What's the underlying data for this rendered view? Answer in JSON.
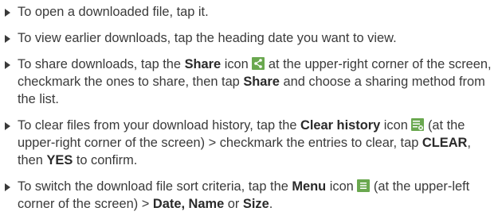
{
  "bullets": [
    {
      "t1": "To open a downloaded file, tap it."
    },
    {
      "t1": "To view earlier downloads, tap the heading date you want to view."
    },
    {
      "t1": "To share downloads, tap the ",
      "b1": "Share",
      "t2": " icon ",
      "icon": "share-icon",
      "t3": " at the upper-right corner of the screen, checkmark the ones to share, then tap ",
      "b2": "Share",
      "t4": " and choose a sharing method from the list."
    },
    {
      "t1": "To clear files from your download history, tap the ",
      "b1": "Clear history",
      "t2": " icon ",
      "icon": "clear-history-icon",
      "t3": " (at the upper-right corner of the screen) > checkmark the entries to clear, tap ",
      "b2": "CLEAR",
      "t4": ", then ",
      "b3": "YES",
      "t5": " to confirm."
    },
    {
      "t1": "To switch the download file sort criteria, tap the ",
      "b1": "Menu",
      "t2": " icon ",
      "icon": "menu-icon",
      "t3": " (at the upper-left corner of the screen) > ",
      "b2": "Date, Name",
      "t4": " or ",
      "b3": "Size",
      "t5": "."
    }
  ],
  "colors": {
    "text": "#3a3a3a",
    "icon_bg": "#6aa84f"
  }
}
